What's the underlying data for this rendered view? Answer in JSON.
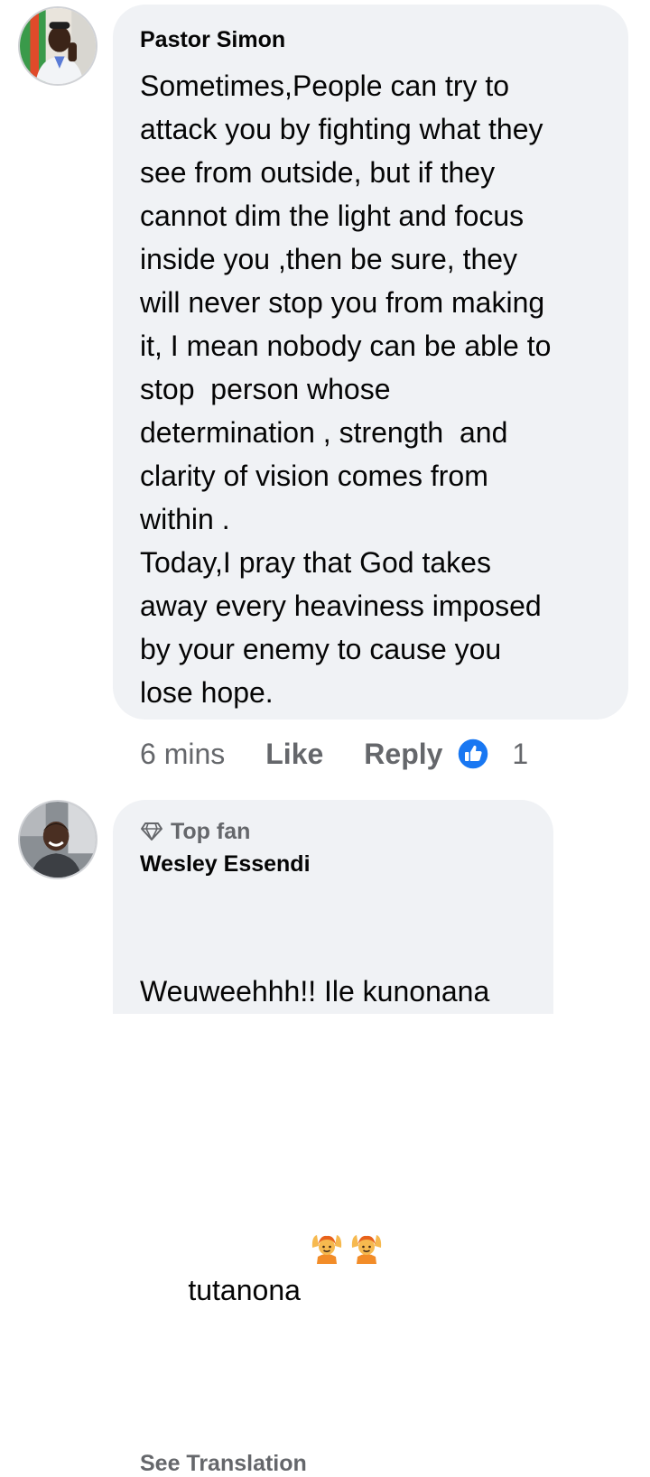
{
  "comments": [
    {
      "author": "Pastor Simon",
      "text": "Sometimes,People can try to\nattack you by fighting what they\nsee from outside, but if they\ncannot dim the light and focus\ninside you ,then be sure, they\nwill never stop you from making\nit, I mean nobody can be able to\nstop  person whose\ndetermination , strength  and\nclarity of vision comes from\nwithin .\nToday,I pray that God takes\naway every heaviness imposed\nby your enemy to cause you\nlose hope.",
      "time": "6 mins",
      "like_label": "Like",
      "reply_label": "Reply",
      "reaction_count": "1",
      "reaction_icon": "thumbs-up-icon"
    },
    {
      "badge": "Top fan",
      "badge_icon": "diamond-icon",
      "author": "Wesley Essendi",
      "text_line1": "Weuweehhh!! Ile kunonana",
      "text_line2": "tutanona",
      "emojis": [
        "person-raising-hands-emoji",
        "person-raising-hands-emoji"
      ],
      "see_translation": "See Translation"
    }
  ],
  "colors": {
    "bubble": "#f0f2f5",
    "muted": "#65676b",
    "like_blue": "#1877f2",
    "text": "#050505"
  }
}
